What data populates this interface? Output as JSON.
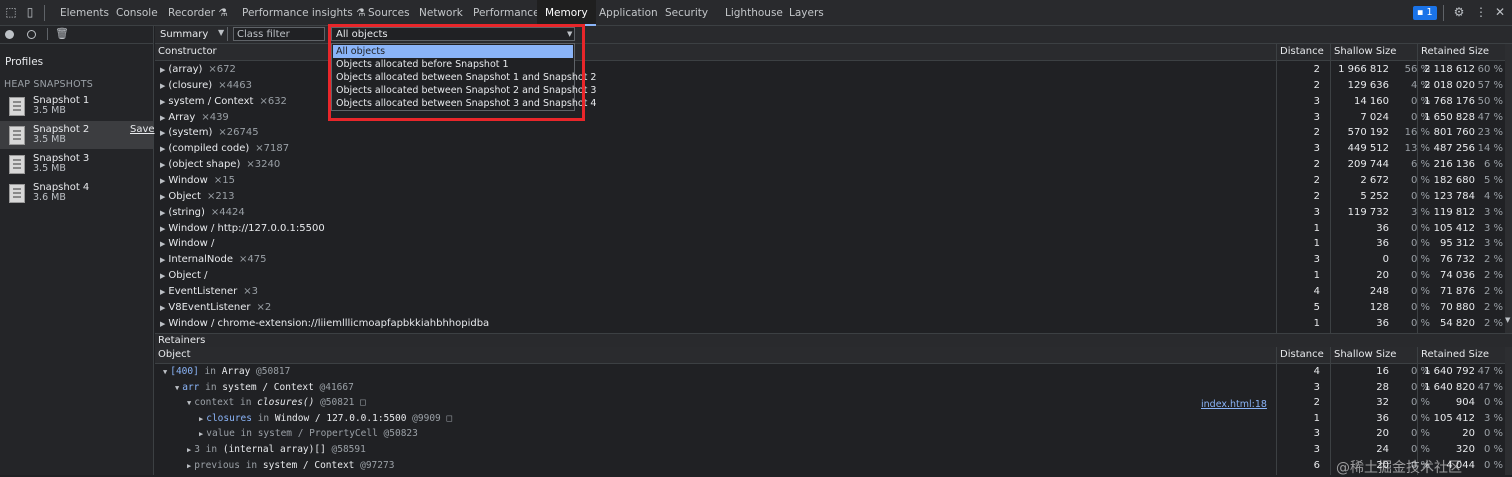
{
  "tabs": [
    {
      "label": "Elements",
      "active": false
    },
    {
      "label": "Console",
      "active": false
    },
    {
      "label": "Recorder",
      "active": false,
      "icon": "flask-icon"
    },
    {
      "label": "Performance insights",
      "active": false,
      "icon": "flask-icon"
    },
    {
      "label": "Sources",
      "active": false
    },
    {
      "label": "Network",
      "active": false
    },
    {
      "label": "Performance",
      "active": false
    },
    {
      "label": "Memory",
      "active": true
    },
    {
      "label": "Application",
      "active": false
    },
    {
      "label": "Security",
      "active": false
    },
    {
      "label": "Lighthouse",
      "active": false
    },
    {
      "label": "Layers",
      "active": false
    }
  ],
  "issues_badge": "1",
  "left": {
    "profiles_title": "Profiles",
    "heap_title": "HEAP SNAPSHOTS",
    "snapshots": [
      {
        "name": "Snapshot 1",
        "size": "3.5 MB"
      },
      {
        "name": "Snapshot 2",
        "size": "3.5 MB",
        "save": "Save",
        "selected": true
      },
      {
        "name": "Snapshot 3",
        "size": "3.5 MB"
      },
      {
        "name": "Snapshot 4",
        "size": "3.6 MB"
      }
    ]
  },
  "toolbar": {
    "view": "Summary",
    "class_filter_placeholder": "Class filter",
    "objects_filter": "All objects",
    "objects_options": [
      "All objects",
      "Objects allocated before Snapshot 1",
      "Objects allocated between Snapshot 1 and Snapshot 2",
      "Objects allocated between Snapshot 2 and Snapshot 3",
      "Objects allocated between Snapshot 3 and Snapshot 4"
    ]
  },
  "columns": {
    "constructor": "Constructor",
    "distance": "Distance",
    "shallow": "Shallow Size",
    "retained": "Retained Size"
  },
  "rows": [
    {
      "name": "(array)",
      "count": "×672",
      "dist": "2",
      "shallow": "1 966 812",
      "spct": "56 %",
      "ret": "2 118 612",
      "rpct": "60 %"
    },
    {
      "name": "(closure)",
      "count": "×4463",
      "dist": "2",
      "shallow": "129 636",
      "spct": "4 %",
      "ret": "2 018 020",
      "rpct": "57 %"
    },
    {
      "name": "system / Context",
      "count": "×632",
      "dist": "3",
      "shallow": "14 160",
      "spct": "0 %",
      "ret": "1 768 176",
      "rpct": "50 %"
    },
    {
      "name": "Array",
      "count": "×439",
      "dist": "3",
      "shallow": "7 024",
      "spct": "0 %",
      "ret": "1 650 828",
      "rpct": "47 %"
    },
    {
      "name": "(system)",
      "count": "×26745",
      "dist": "2",
      "shallow": "570 192",
      "spct": "16 %",
      "ret": "801 760",
      "rpct": "23 %"
    },
    {
      "name": "(compiled code)",
      "count": "×7187",
      "dist": "3",
      "shallow": "449 512",
      "spct": "13 %",
      "ret": "487 256",
      "rpct": "14 %"
    },
    {
      "name": "(object shape)",
      "count": "×3240",
      "dist": "2",
      "shallow": "209 744",
      "spct": "6 %",
      "ret": "216 136",
      "rpct": "6 %"
    },
    {
      "name": "Window",
      "count": "×15",
      "dist": "2",
      "shallow": "2 672",
      "spct": "0 %",
      "ret": "182 680",
      "rpct": "5 %"
    },
    {
      "name": "Object",
      "count": "×213",
      "dist": "2",
      "shallow": "5 252",
      "spct": "0 %",
      "ret": "123 784",
      "rpct": "4 %"
    },
    {
      "name": "(string)",
      "count": "×4424",
      "dist": "3",
      "shallow": "119 732",
      "spct": "3 %",
      "ret": "119 812",
      "rpct": "3 %"
    },
    {
      "name": "Window / http://127.0.0.1:5500",
      "count": "",
      "dist": "1",
      "shallow": "36",
      "spct": "0 %",
      "ret": "105 412",
      "rpct": "3 %"
    },
    {
      "name": "Window /",
      "count": "",
      "dist": "1",
      "shallow": "36",
      "spct": "0 %",
      "ret": "95 312",
      "rpct": "3 %"
    },
    {
      "name": "InternalNode",
      "count": "×475",
      "dist": "3",
      "shallow": "0",
      "spct": "0 %",
      "ret": "76 732",
      "rpct": "2 %"
    },
    {
      "name": "Object /",
      "count": "",
      "dist": "1",
      "shallow": "20",
      "spct": "0 %",
      "ret": "74 036",
      "rpct": "2 %"
    },
    {
      "name": "EventListener",
      "count": "×3",
      "dist": "4",
      "shallow": "248",
      "spct": "0 %",
      "ret": "71 876",
      "rpct": "2 %"
    },
    {
      "name": "V8EventListener",
      "count": "×2",
      "dist": "5",
      "shallow": "128",
      "spct": "0 %",
      "ret": "70 880",
      "rpct": "2 %"
    },
    {
      "name": "Window / chrome-extension://liiemlllicmoapfapbkkiahbhhopidba",
      "count": "",
      "dist": "1",
      "shallow": "36",
      "spct": "0 %",
      "ret": "54 820",
      "rpct": "2 %"
    }
  ],
  "retainers": {
    "title": "Retainers",
    "columns": {
      "object": "Object",
      "distance": "Distance",
      "shallow": "Shallow Size",
      "retained": "Retained Size"
    },
    "link": "index.html:18",
    "rows": [
      {
        "parts": [
          {
            "t": "[400]",
            "c": "k"
          },
          {
            "t": " in ",
            "c": "g"
          },
          {
            "t": "Array",
            "c": "w"
          },
          {
            "t": " @50817",
            "c": "g"
          }
        ],
        "indent": 0,
        "dist": "4",
        "shallow": "16",
        "spct": "0 %",
        "ret": "1 640 792",
        "rpct": "47 %"
      },
      {
        "parts": [
          {
            "t": "arr",
            "c": "k"
          },
          {
            "t": " in ",
            "c": "g"
          },
          {
            "t": "system / Context",
            "c": "w"
          },
          {
            "t": " @41667",
            "c": "g"
          }
        ],
        "indent": 1,
        "dist": "3",
        "shallow": "28",
        "spct": "0 %",
        "ret": "1 640 820",
        "rpct": "47 %"
      },
      {
        "parts": [
          {
            "t": "context",
            "c": "g"
          },
          {
            "t": " in ",
            "c": "g"
          },
          {
            "t": "closures()",
            "c": "it"
          },
          {
            "t": " @50821 ",
            "c": "g"
          },
          {
            "t": "□",
            "c": "g"
          }
        ],
        "indent": 2,
        "dist": "2",
        "shallow": "32",
        "spct": "0 %",
        "ret": "904",
        "rpct": "0 %"
      },
      {
        "parts": [
          {
            "t": "closures",
            "c": "k"
          },
          {
            "t": " in ",
            "c": "g"
          },
          {
            "t": "Window / 127.0.0.1:5500",
            "c": "w"
          },
          {
            "t": " @9909 ",
            "c": "g"
          },
          {
            "t": "□",
            "c": "g"
          }
        ],
        "indent": 3,
        "dist": "1",
        "shallow": "36",
        "spct": "0 %",
        "ret": "105 412",
        "rpct": "3 %"
      },
      {
        "parts": [
          {
            "t": "value",
            "c": "g"
          },
          {
            "t": " in system / PropertyCell",
            "c": "g"
          },
          {
            "t": " @50823",
            "c": "g"
          }
        ],
        "indent": 3,
        "dist": "3",
        "shallow": "20",
        "spct": "0 %",
        "ret": "20",
        "rpct": "0 %"
      },
      {
        "parts": [
          {
            "t": "3",
            "c": "g"
          },
          {
            "t": " in ",
            "c": "g"
          },
          {
            "t": "(internal array)[]",
            "c": "w"
          },
          {
            "t": " @58591",
            "c": "g"
          }
        ],
        "indent": 2,
        "dist": "3",
        "shallow": "24",
        "spct": "0 %",
        "ret": "320",
        "rpct": "0 %"
      },
      {
        "parts": [
          {
            "t": "previous",
            "c": "g"
          },
          {
            "t": " in ",
            "c": "g"
          },
          {
            "t": "system / Context",
            "c": "w"
          },
          {
            "t": " @97273",
            "c": "g"
          }
        ],
        "indent": 2,
        "dist": "6",
        "shallow": "20",
        "spct": "0 %",
        "ret": "4 044",
        "rpct": "0 %"
      }
    ]
  },
  "watermark": "@稀土掘金技术社区"
}
